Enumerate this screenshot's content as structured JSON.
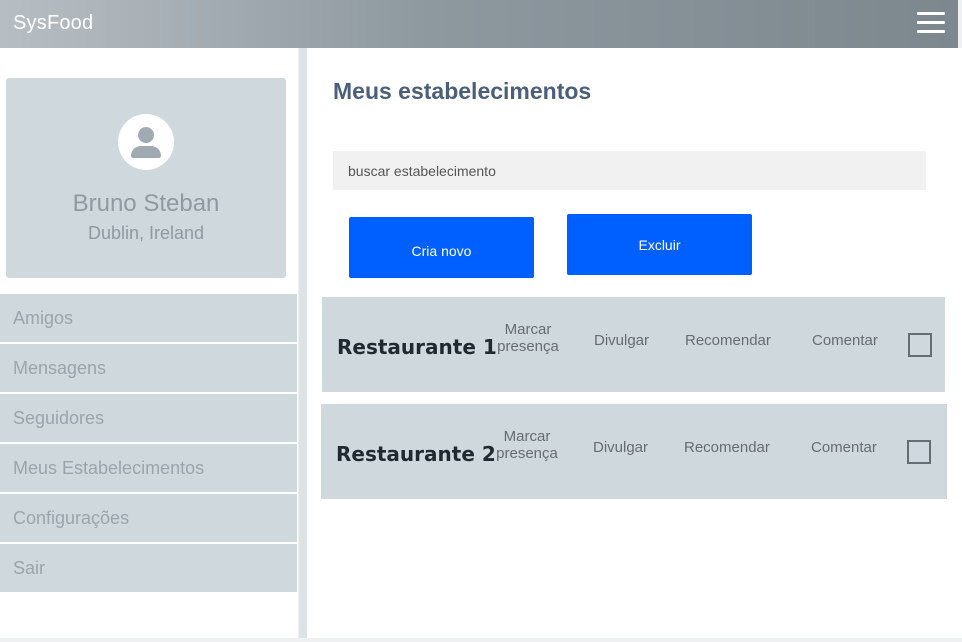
{
  "app": {
    "title": "SysFood"
  },
  "profile": {
    "name": "Bruno Steban",
    "location": "Dublin, Ireland"
  },
  "nav": [
    {
      "label": "Amigos"
    },
    {
      "label": "Mensagens"
    },
    {
      "label": "Seguidores"
    },
    {
      "label": "Meus Estabelecimentos"
    },
    {
      "label": "Configurações"
    },
    {
      "label": "Sair"
    }
  ],
  "main": {
    "title": "Meus estabelecimentos",
    "search_placeholder": "buscar estabelecimento",
    "create_label": "Cria novo",
    "delete_label": "Excluir"
  },
  "restaurants": [
    {
      "name": "Restaurante 1",
      "mark_line1": "Marcar",
      "mark_line2": "presença",
      "share": "Divulgar",
      "recommend": "Recomendar",
      "comment": "Comentar",
      "checked": false
    },
    {
      "name": "Restaurante 2",
      "mark_line1": "Marcar",
      "mark_line2": "presença",
      "share": "Divulgar",
      "recommend": "Recomendar",
      "comment": "Comentar",
      "checked": false
    }
  ],
  "colors": {
    "accent": "#0060ff",
    "panel": "#cfd8dc",
    "title": "#4b5f7a"
  }
}
